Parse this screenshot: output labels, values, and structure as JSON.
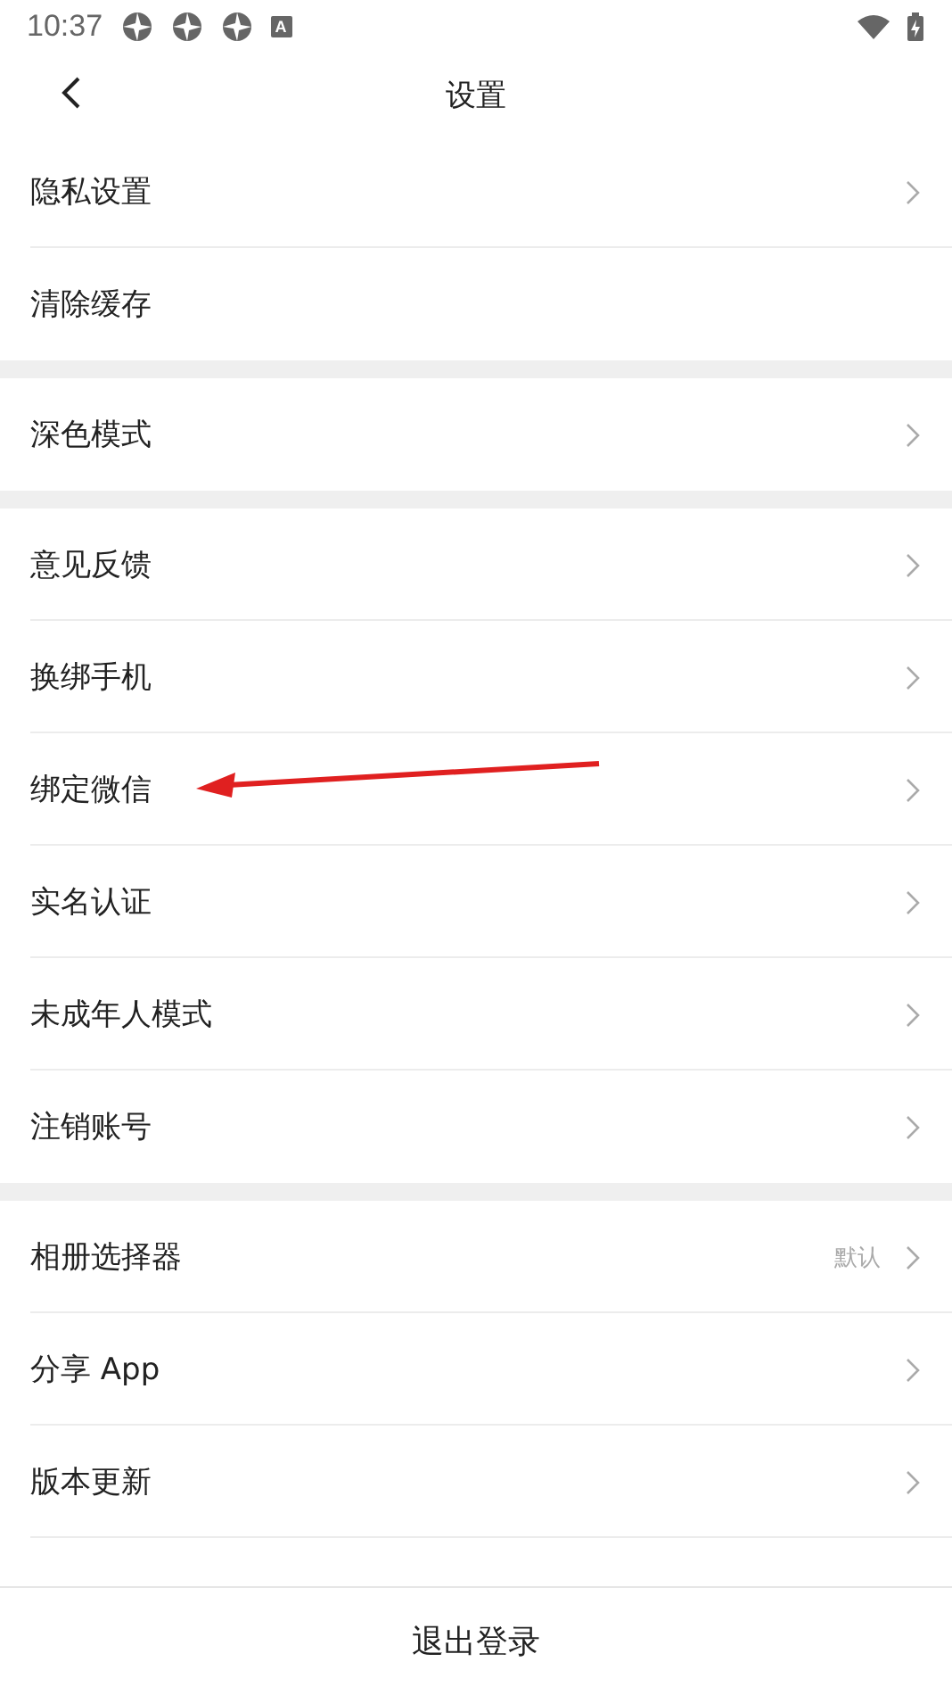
{
  "status_bar": {
    "time": "10:37",
    "keyboard_icon": "A"
  },
  "header": {
    "title": "设置"
  },
  "sections": [
    {
      "items": [
        {
          "label": "隐私设置",
          "chevron": true
        },
        {
          "label": "清除缓存",
          "chevron": false
        }
      ]
    },
    {
      "items": [
        {
          "label": "深色模式",
          "chevron": true
        }
      ]
    },
    {
      "items": [
        {
          "label": "意见反馈",
          "chevron": true
        },
        {
          "label": "换绑手机",
          "chevron": true
        },
        {
          "label": "绑定微信",
          "chevron": true
        },
        {
          "label": "实名认证",
          "chevron": true
        },
        {
          "label": "未成年人模式",
          "chevron": true
        },
        {
          "label": "注销账号",
          "chevron": true
        }
      ]
    },
    {
      "items": [
        {
          "label": "相册选择器",
          "value": "默认",
          "chevron": true
        },
        {
          "label": "分享 App",
          "chevron": true
        },
        {
          "label": "版本更新",
          "chevron": true
        }
      ]
    }
  ],
  "logout_button": "退出登录"
}
